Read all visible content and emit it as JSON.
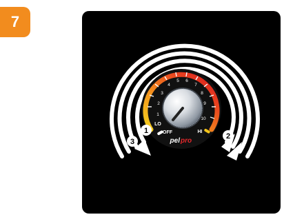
{
  "step": {
    "number": "7",
    "color": "#f28c1e"
  },
  "panel": {
    "background": "#000000"
  },
  "dial": {
    "label_off": "OFF",
    "label_lo": "LO",
    "label_hi": "HI",
    "scale_numbers": [
      "1",
      "2",
      "3",
      "4",
      "5",
      "6",
      "7",
      "8",
      "9",
      "10"
    ],
    "brand_left": "pel",
    "brand_right": "pro",
    "brand_right_color": "#e4282b",
    "knob_icon": "rotary-knob-icon"
  },
  "callouts": [
    {
      "number": "1"
    },
    {
      "number": "2"
    },
    {
      "number": "3"
    }
  ],
  "arrows": {
    "icon": "rotation-arrow-icon",
    "color": "#ffffff"
  }
}
